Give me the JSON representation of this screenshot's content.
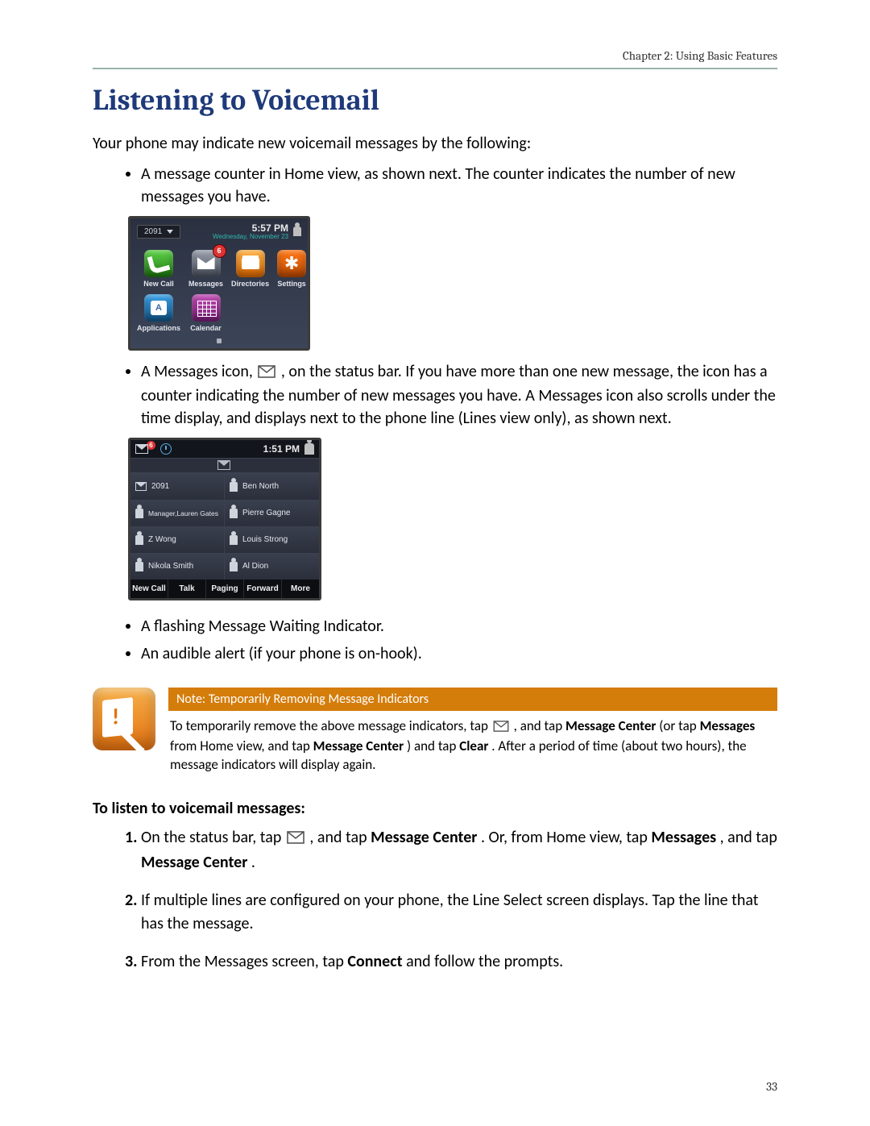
{
  "header": {
    "chapter": "Chapter 2: Using Basic Features"
  },
  "title": "Listening to Voicemail",
  "intro": "Your phone may indicate new voicemail messages by the following:",
  "bullets_top": [
    "A message counter in Home view, as shown next. The counter indicates the number of new messages you have."
  ],
  "bullets_mid_prefix": "A Messages icon, ",
  "bullets_mid_suffix": ", on the status bar. If you have more than one new message, the icon has a counter indicating the number of new messages you have. A Messages icon also scrolls under the time display, and displays next to the phone line (Lines view only), as shown next.",
  "bullets_after": [
    "A flashing Message Waiting Indicator.",
    "An audible alert (if your phone is on-hook)."
  ],
  "note": {
    "title": "Note: Temporarily Removing Message Indicators",
    "t1": "To temporarily remove the above message indicators, tap ",
    "t2": ", and tap ",
    "b1": "Message Center",
    "t3": " (or tap ",
    "b2": "Messages",
    "t4": " from Home view, and tap ",
    "b3": "Message Center",
    "t5": ") and tap ",
    "b4": "Clear",
    "t6": ". After a period of time (about two hours), the message indicators will display again."
  },
  "subhead": "To listen to voicemail messages:",
  "steps": {
    "s1a": "On the status bar, tap ",
    "s1b": ", and tap ",
    "s1_b1": "Message Center",
    "s1c": ". Or, from Home view, tap ",
    "s1_b2": "Messages",
    "s1d": ", and tap ",
    "s1_b3": "Message Center",
    "s1e": ".",
    "s2": "If multiple lines are configured on your phone, the Line Select screen displays. Tap the line that has the message.",
    "s3a": "From the Messages screen, tap ",
    "s3_b1": "Connect",
    "s3b": " and follow the prompts."
  },
  "home_view": {
    "line": "2091",
    "time": "5:57 PM",
    "date": "Wednesday, November 23",
    "badge": "6",
    "tiles": [
      {
        "label": "New Call"
      },
      {
        "label": "Messages"
      },
      {
        "label": "Directories"
      },
      {
        "label": "Settings"
      },
      {
        "label": "Applications"
      },
      {
        "label": "Calendar"
      }
    ]
  },
  "lines_view": {
    "time": "1:51 PM",
    "badge": "6",
    "rows": [
      [
        "2091",
        "Ben North"
      ],
      [
        "Manager,Lauren Gates",
        "Pierre Gagne"
      ],
      [
        "Z Wong",
        "Louis Strong"
      ],
      [
        "Nikola Smith",
        "Al Dion"
      ]
    ],
    "softkeys": [
      "New Call",
      "Talk",
      "Paging",
      "Forward",
      "More"
    ]
  },
  "page_number": "33"
}
